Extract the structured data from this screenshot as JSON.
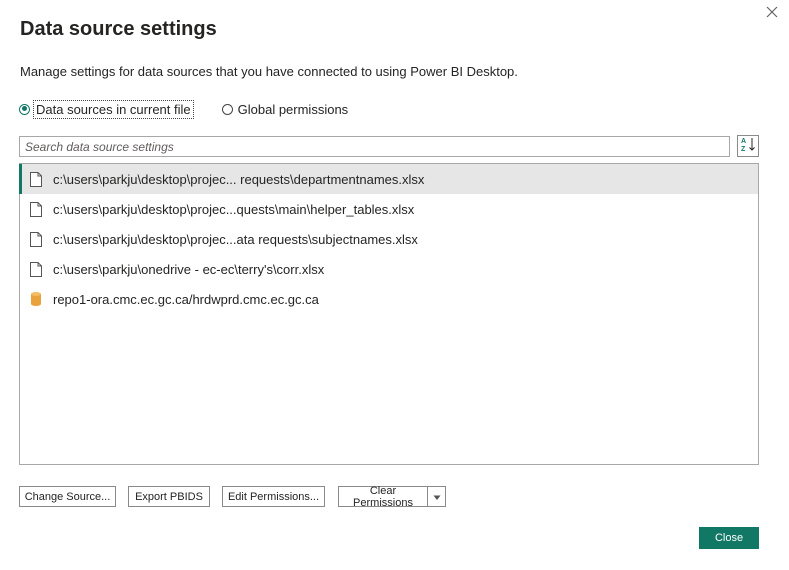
{
  "dialog": {
    "title": "Data source settings",
    "subtitle": "Manage settings for data sources that you have connected to using Power BI Desktop.",
    "close_icon": "close-icon"
  },
  "scope": {
    "options": [
      {
        "label": "Data sources in current file",
        "selected": true
      },
      {
        "label": "Global permissions",
        "selected": false
      }
    ]
  },
  "search": {
    "placeholder": "Search data source settings",
    "value": "",
    "sort_icon": "sort-az-icon"
  },
  "sources": [
    {
      "label": "c:\\users\\parkju\\desktop\\projec... requests\\departmentnames.xlsx",
      "icon": "file-icon",
      "selected": true
    },
    {
      "label": "c:\\users\\parkju\\desktop\\projec...quests\\main\\helper_tables.xlsx",
      "icon": "file-icon",
      "selected": false
    },
    {
      "label": "c:\\users\\parkju\\desktop\\projec...ata requests\\subjectnames.xlsx",
      "icon": "file-icon",
      "selected": false
    },
    {
      "label": "c:\\users\\parkju\\onedrive - ec-ec\\terry's\\corr.xlsx",
      "icon": "file-icon",
      "selected": false
    },
    {
      "label": "repo1-ora.cmc.ec.gc.ca/hrdwprd.cmc.ec.gc.ca",
      "icon": "database-icon",
      "selected": false
    }
  ],
  "actions": {
    "change_source": "Change Source...",
    "export_pbids": "Export PBIDS",
    "edit_permissions": "Edit Permissions...",
    "clear_permissions": "Clear Permissions",
    "close": "Close"
  },
  "colors": {
    "accent": "#117865",
    "selected_row": "#e6e6e6",
    "database_icon": "#e8a33c"
  }
}
